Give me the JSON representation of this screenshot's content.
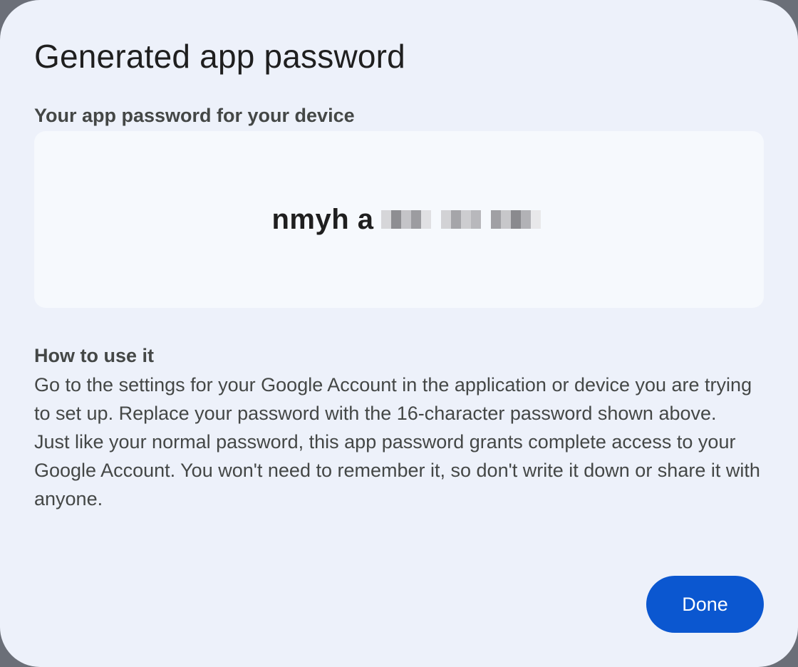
{
  "dialog": {
    "title": "Generated app password",
    "password_label": "Your app password for your device",
    "password_visible": "nmyh a",
    "help_heading": "How to use it",
    "help_paragraphs": [
      "Go to the settings for your Google Account in the application or device you are trying to set up. Replace your password with the 16-character password shown above.",
      "Just like your normal password, this app password grants complete access to your Google Account. You won't need to remember it, so don't write it down or share it with anyone."
    ],
    "done_label": "Done"
  },
  "colors": {
    "dialog_bg": "#edf1fa",
    "password_box_bg": "#f6f9fd",
    "primary_button": "#0b57d0",
    "text_primary": "#1f1f1f",
    "text_secondary": "#444746"
  }
}
